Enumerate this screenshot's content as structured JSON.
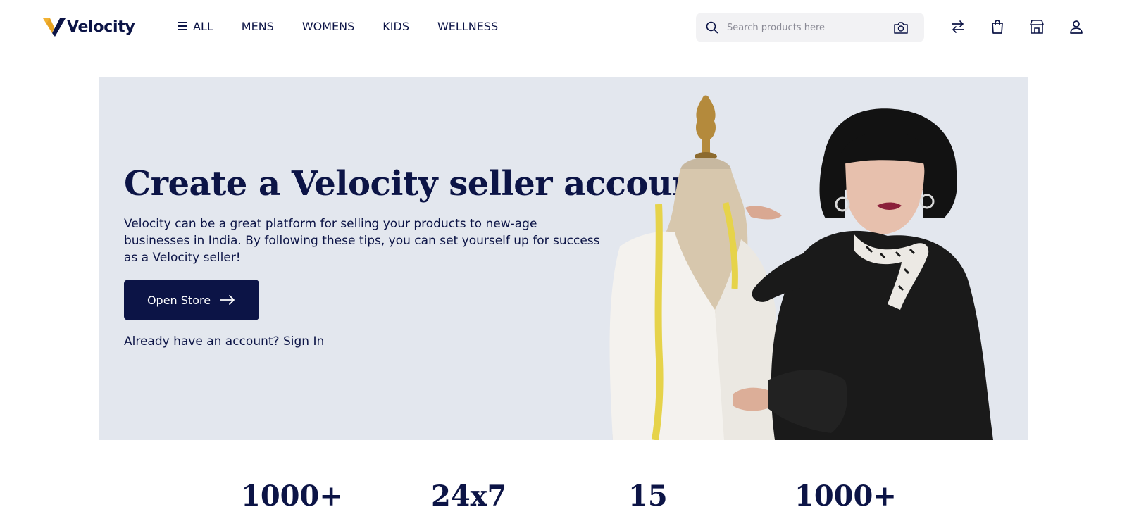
{
  "brand": {
    "name": "Velocity",
    "primary_color": "#0c1446",
    "accent_color": "#f2b233"
  },
  "nav": {
    "items": [
      {
        "label": "ALL",
        "icon": "menu-icon"
      },
      {
        "label": "MENS"
      },
      {
        "label": "WOMENS"
      },
      {
        "label": "KIDS"
      },
      {
        "label": "WELLNESS"
      }
    ]
  },
  "search": {
    "placeholder": "Search products here",
    "icon": "search-icon",
    "camera_icon": "camera-icon"
  },
  "header_icons": [
    "swap-icon",
    "shopping-bag-icon",
    "store-icon",
    "user-icon"
  ],
  "hero": {
    "title": "Create a Velocity seller account",
    "description": "Velocity can be a great platform for selling your products to new-age businesses in India. By following these tips, you can set yourself up for success as a Velocity seller!",
    "cta_label": "Open Store",
    "signin_prompt": "Already have an account?",
    "signin_link": "Sign In",
    "background": "#e3e7ee"
  },
  "stats": [
    "1000+",
    "24x7",
    "15",
    "1000+"
  ]
}
